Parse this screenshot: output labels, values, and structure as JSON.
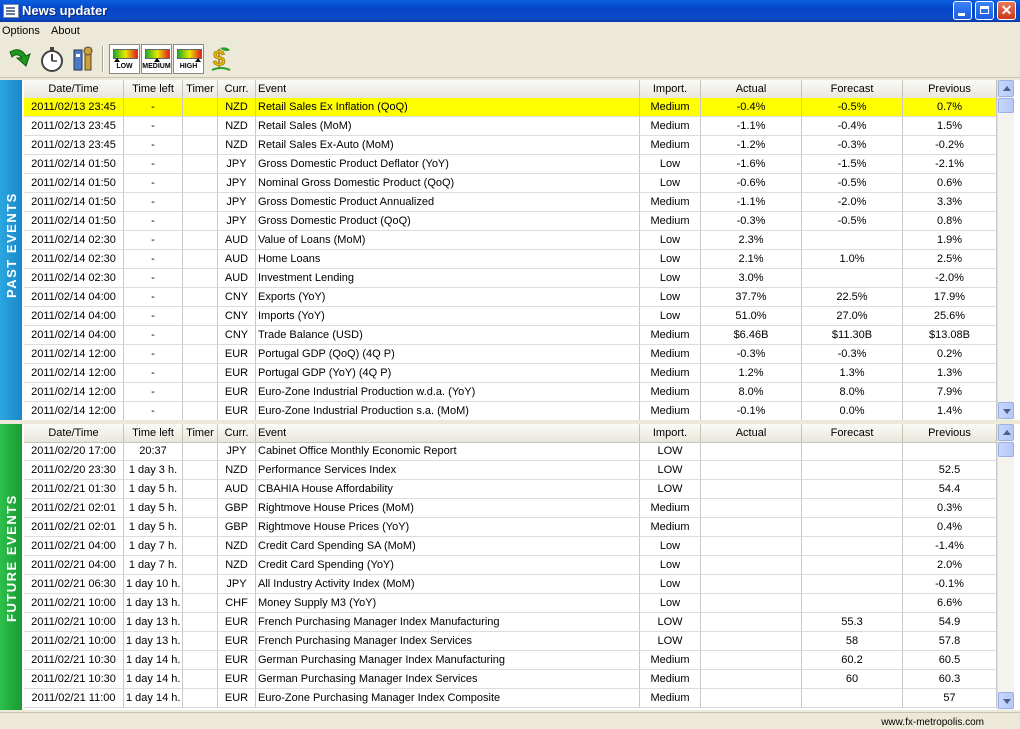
{
  "window": {
    "title": "News updater"
  },
  "menu": [
    {
      "label": "Options"
    },
    {
      "label": "About"
    }
  ],
  "toolbar": {
    "tools": [
      {
        "name": "refresh-icon"
      },
      {
        "name": "stopwatch-icon"
      },
      {
        "name": "settings-tools-icon"
      }
    ],
    "importance_buttons": [
      {
        "label": "LOW",
        "arrow_color": "#21b021"
      },
      {
        "label": "MEDIUM",
        "arrow_color": "#c0c000"
      },
      {
        "label": "HIGH",
        "arrow_color": "#e02020"
      }
    ],
    "currency_icon": "dollar-plant-icon"
  },
  "columns": [
    "Date/Time",
    "Time left",
    "Timer",
    "Curr.",
    "Event",
    "Import.",
    "Actual",
    "Forecast",
    "Previous"
  ],
  "past": {
    "label": "PAST EVENTS",
    "accent": "#2aa7e0",
    "selected_row": 0,
    "rows": [
      [
        "2011/02/13 23:45",
        "-",
        "",
        "NZD",
        "Retail Sales Ex Inflation (QoQ)",
        "Medium",
        "-0.4%",
        "-0.5%",
        "0.7%"
      ],
      [
        "2011/02/13 23:45",
        "-",
        "",
        "NZD",
        "Retail Sales (MoM)",
        "Medium",
        "-1.1%",
        "-0.4%",
        "1.5%"
      ],
      [
        "2011/02/13 23:45",
        "-",
        "",
        "NZD",
        "Retail Sales Ex-Auto (MoM)",
        "Medium",
        "-1.2%",
        "-0.3%",
        "-0.2%"
      ],
      [
        "2011/02/14 01:50",
        "-",
        "",
        "JPY",
        "Gross Domestic Product Deflator (YoY)",
        "Low",
        "-1.6%",
        "-1.5%",
        "-2.1%"
      ],
      [
        "2011/02/14 01:50",
        "-",
        "",
        "JPY",
        "Nominal Gross Domestic Product (QoQ)",
        "Low",
        "-0.6%",
        "-0.5%",
        "0.6%"
      ],
      [
        "2011/02/14 01:50",
        "-",
        "",
        "JPY",
        "Gross Domestic Product Annualized",
        "Medium",
        "-1.1%",
        "-2.0%",
        "3.3%"
      ],
      [
        "2011/02/14 01:50",
        "-",
        "",
        "JPY",
        "Gross Domestic Product (QoQ)",
        "Medium",
        "-0.3%",
        "-0.5%",
        "0.8%"
      ],
      [
        "2011/02/14 02:30",
        "-",
        "",
        "AUD",
        "Value of Loans (MoM)",
        "Low",
        "2.3%",
        "",
        "1.9%"
      ],
      [
        "2011/02/14 02:30",
        "-",
        "",
        "AUD",
        "Home Loans",
        "Low",
        "2.1%",
        "1.0%",
        "2.5%"
      ],
      [
        "2011/02/14 02:30",
        "-",
        "",
        "AUD",
        "Investment Lending",
        "Low",
        "3.0%",
        "",
        "-2.0%"
      ],
      [
        "2011/02/14 04:00",
        "-",
        "",
        "CNY",
        "Exports (YoY)",
        "Low",
        "37.7%",
        "22.5%",
        "17.9%"
      ],
      [
        "2011/02/14 04:00",
        "-",
        "",
        "CNY",
        "Imports (YoY)",
        "Low",
        "51.0%",
        "27.0%",
        "25.6%"
      ],
      [
        "2011/02/14 04:00",
        "-",
        "",
        "CNY",
        "Trade Balance (USD)",
        "Medium",
        "$6.46B",
        "$11.30B",
        "$13.08B"
      ],
      [
        "2011/02/14 12:00",
        "-",
        "",
        "EUR",
        "Portugal GDP (QoQ) (4Q P)",
        "Medium",
        "-0.3%",
        "-0.3%",
        "0.2%"
      ],
      [
        "2011/02/14 12:00",
        "-",
        "",
        "EUR",
        "Portugal GDP (YoY) (4Q P)",
        "Medium",
        "1.2%",
        "1.3%",
        "1.3%"
      ],
      [
        "2011/02/14 12:00",
        "-",
        "",
        "EUR",
        "Euro-Zone Industrial Production w.d.a. (YoY)",
        "Medium",
        "8.0%",
        "8.0%",
        "7.9%"
      ],
      [
        "2011/02/14 12:00",
        "-",
        "",
        "EUR",
        "Euro-Zone Industrial Production s.a. (MoM)",
        "Medium",
        "-0.1%",
        "0.0%",
        "1.4%"
      ]
    ]
  },
  "future": {
    "label": "FUTURE EVENTS",
    "accent": "#2cc04a",
    "rows": [
      [
        "2011/02/20 17:00",
        "20:37",
        "",
        "JPY",
        "Cabinet Office Monthly Economic Report",
        "LOW",
        "",
        "",
        ""
      ],
      [
        "2011/02/20 23:30",
        "1 day 3 h.",
        "",
        "NZD",
        "Performance Services Index",
        "LOW",
        "",
        "",
        "52.5"
      ],
      [
        "2011/02/21 01:30",
        "1 day 5 h.",
        "",
        "AUD",
        "CBAHIA House Affordability",
        "LOW",
        "",
        "",
        "54.4"
      ],
      [
        "2011/02/21 02:01",
        "1 day 5 h.",
        "",
        "GBP",
        "Rightmove House Prices (MoM)",
        "Medium",
        "",
        "",
        "0.3%"
      ],
      [
        "2011/02/21 02:01",
        "1 day 5 h.",
        "",
        "GBP",
        "Rightmove House Prices (YoY)",
        "Medium",
        "",
        "",
        "0.4%"
      ],
      [
        "2011/02/21 04:00",
        "1 day 7 h.",
        "",
        "NZD",
        "Credit Card Spending SA (MoM)",
        "Low",
        "",
        "",
        "-1.4%"
      ],
      [
        "2011/02/21 04:00",
        "1 day 7 h.",
        "",
        "NZD",
        "Credit Card Spending (YoY)",
        "Low",
        "",
        "",
        "2.0%"
      ],
      [
        "2011/02/21 06:30",
        "1 day 10 h.",
        "",
        "JPY",
        "All Industry Activity Index (MoM)",
        "Low",
        "",
        "",
        "-0.1%"
      ],
      [
        "2011/02/21 10:00",
        "1 day 13 h.",
        "",
        "CHF",
        "Money Supply M3 (YoY)",
        "Low",
        "",
        "",
        "6.6%"
      ],
      [
        "2011/02/21 10:00",
        "1 day 13 h.",
        "",
        "EUR",
        "French Purchasing Manager Index Manufacturing",
        "LOW",
        "",
        "55.3",
        "54.9"
      ],
      [
        "2011/02/21 10:00",
        "1 day 13 h.",
        "",
        "EUR",
        "French Purchasing Manager Index Services",
        "LOW",
        "",
        "58",
        "57.8"
      ],
      [
        "2011/02/21 10:30",
        "1 day 14 h.",
        "",
        "EUR",
        "German Purchasing Manager Index Manufacturing",
        "Medium",
        "",
        "60.2",
        "60.5"
      ],
      [
        "2011/02/21 10:30",
        "1 day 14 h.",
        "",
        "EUR",
        "German Purchasing Manager Index Services",
        "Medium",
        "",
        "60",
        "60.3"
      ],
      [
        "2011/02/21 11:00",
        "1 day 14 h.",
        "",
        "EUR",
        "Euro-Zone Purchasing Manager Index Composite",
        "Medium",
        "",
        "",
        "57"
      ]
    ]
  },
  "status": {
    "text": "www.fx-metropolis.com"
  }
}
